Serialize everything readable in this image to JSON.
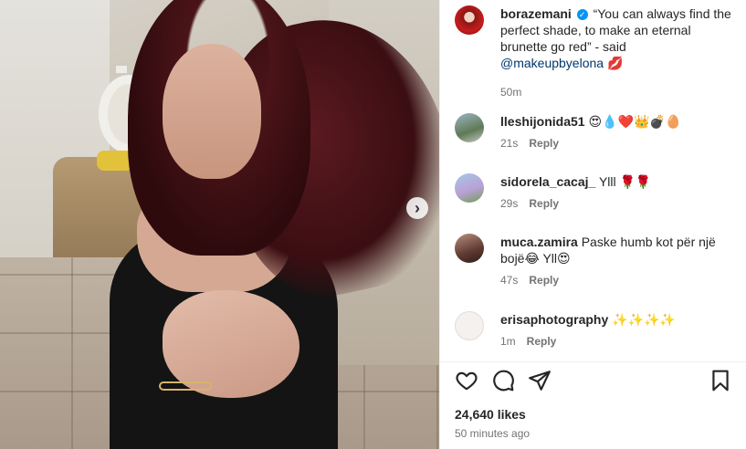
{
  "post": {
    "next_arrow": "›"
  },
  "caption": {
    "username": "borazemani",
    "verified_mark": "✓",
    "text": "“You can always find the perfect shade, to make an eternal brunette go red” - said",
    "mention": "@makeupbyelona",
    "emoji": "💋",
    "time": "50m"
  },
  "comments": [
    {
      "username": "lleshijonida51",
      "text": "😍💧❤️👑💣🥚",
      "time": "21s",
      "reply": "Reply"
    },
    {
      "username": "sidorela_cacaj_",
      "text": "Ylll 🌹🌹",
      "time": "29s",
      "reply": "Reply"
    },
    {
      "username": "muca.zamira",
      "text": "Paske humb kot për një bojë😂 Yll😍",
      "time": "47s",
      "reply": "Reply"
    },
    {
      "username": "erisaphotography",
      "text": "✨✨✨✨",
      "time": "1m",
      "reply": "Reply"
    }
  ],
  "actions": {
    "like_icon": "heart-icon",
    "comment_icon": "comment-icon",
    "share_icon": "share-icon",
    "save_icon": "bookmark-icon"
  },
  "footer": {
    "likes": "24,640 likes",
    "timestamp": "50 minutes ago"
  },
  "colors": {
    "verified": "#0095f6",
    "mention": "#00376b",
    "secondary_text": "#737373"
  }
}
